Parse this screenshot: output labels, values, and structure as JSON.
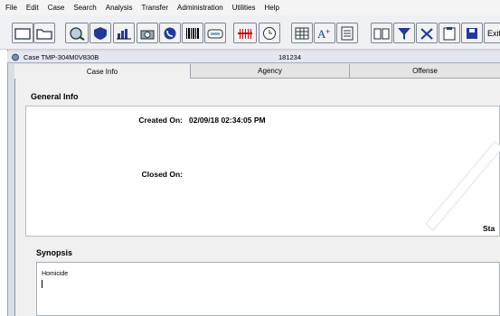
{
  "menu": [
    "File",
    "Edit",
    "Case",
    "Search",
    "Analysis",
    "Transfer",
    "Administration",
    "Utilities",
    "Help"
  ],
  "toolbar": {
    "exit_label": "Exit"
  },
  "window": {
    "case_title": "Case TMP-304M0V830B",
    "case_number": "181234"
  },
  "tabs": [
    {
      "label": "Case Info",
      "active": true
    },
    {
      "label": "Agency",
      "active": false
    },
    {
      "label": "Offense",
      "active": false
    }
  ],
  "general_info": {
    "header": "General Info",
    "created_on_label": "Created On:",
    "created_on_value": "02/09/18 02:34:05 PM",
    "closed_on_label": "Closed On:",
    "closed_on_value": "",
    "status_partial": "Sta"
  },
  "synopsis": {
    "header": "Synopsis",
    "text": "Homicide"
  }
}
